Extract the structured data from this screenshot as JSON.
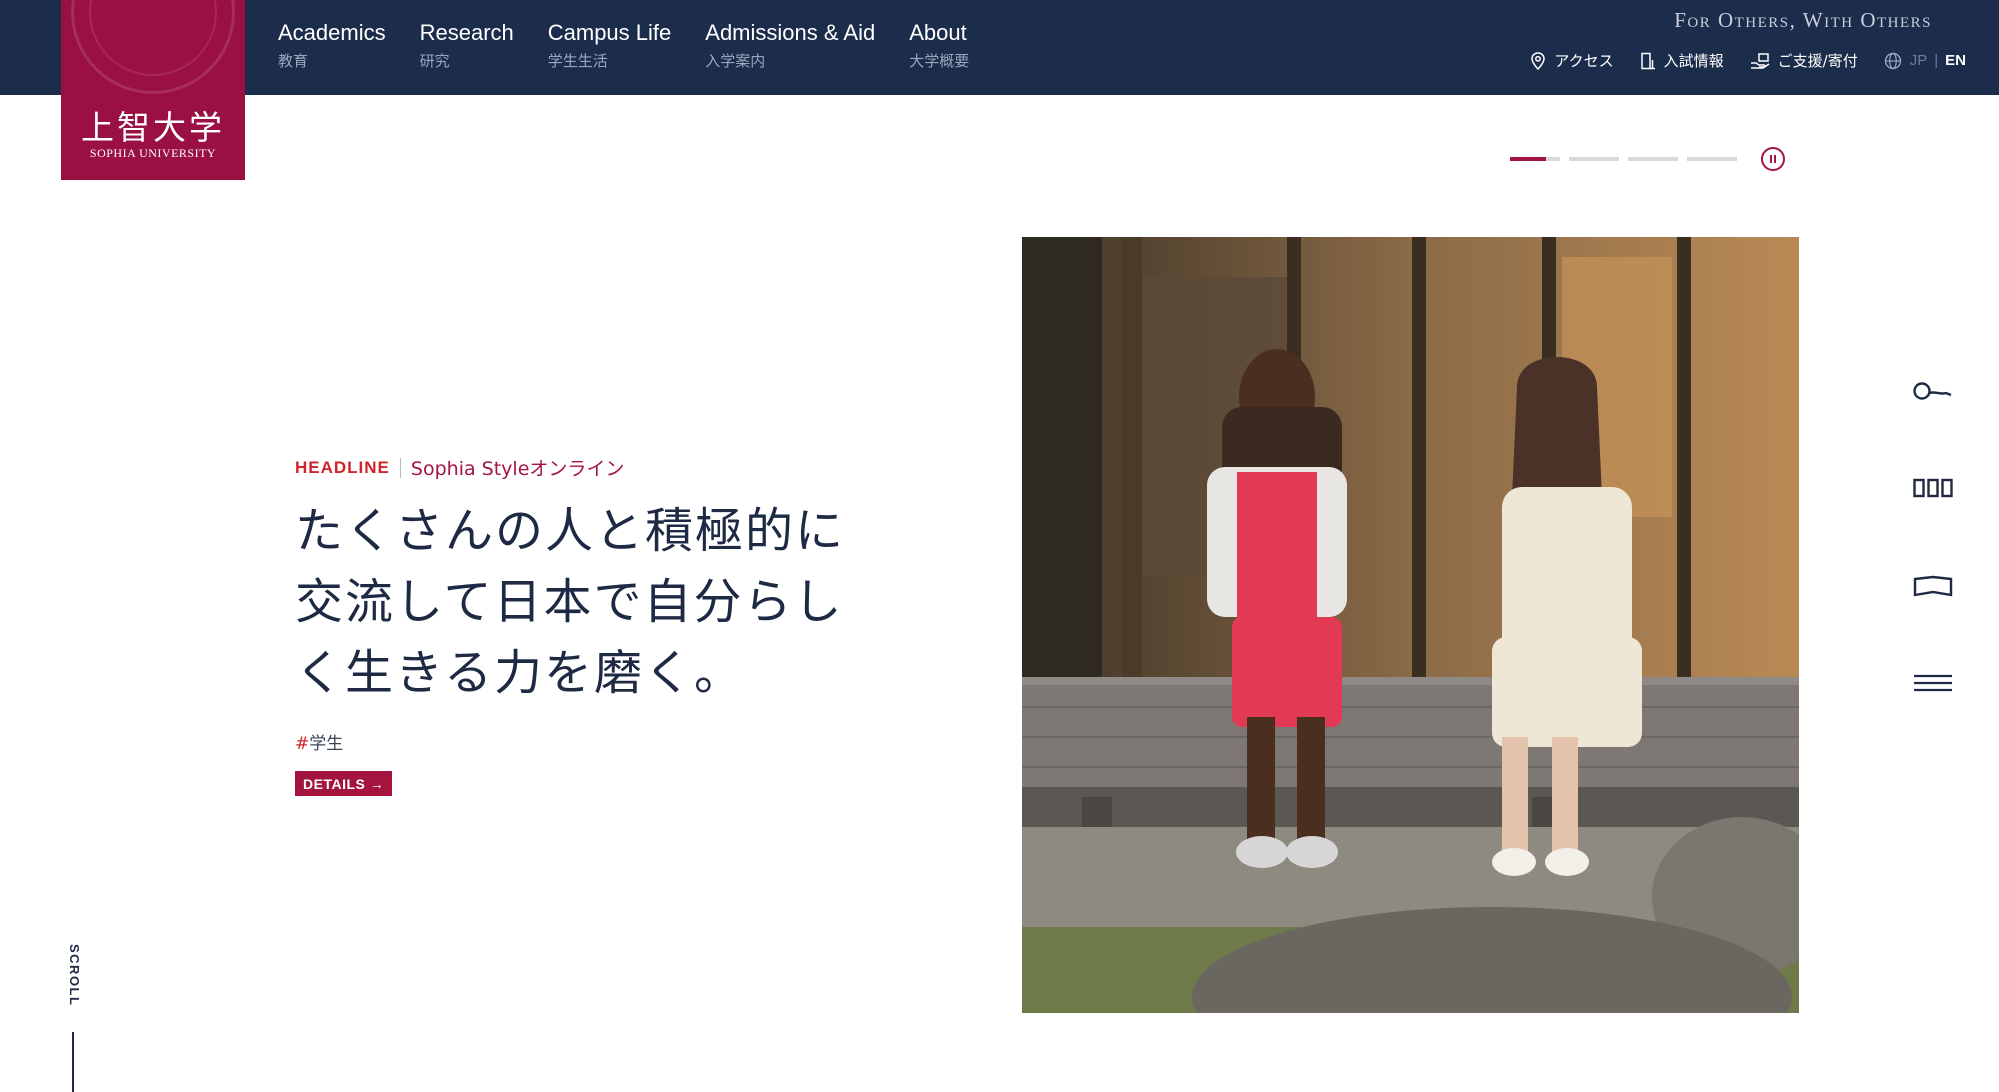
{
  "header": {
    "logo": {
      "kanji": "上智大学",
      "english": "SOPHIA UNIVERSITY"
    },
    "nav": [
      {
        "en": "Academics",
        "jp": "教育"
      },
      {
        "en": "Research",
        "jp": "研究"
      },
      {
        "en": "Campus Life",
        "jp": "学生生活"
      },
      {
        "en": "Admissions & Aid",
        "jp": "入学案内"
      },
      {
        "en": "About",
        "jp": "大学概要"
      }
    ],
    "motto": "For Others, With Others",
    "utility": [
      {
        "label": "アクセス",
        "icon": "map-pin-icon"
      },
      {
        "label": "入試情報",
        "icon": "building-icon"
      },
      {
        "label": "ご支援/寄付",
        "icon": "donation-icon"
      }
    ],
    "lang": {
      "jp": "JP",
      "sep": "|",
      "en": "EN",
      "icon": "globe-icon"
    }
  },
  "slider": {
    "active_index": 0,
    "active_progress": 0.72,
    "count": 4
  },
  "headline": {
    "label": "HEADLINE",
    "source": "Sophia Styleオンライン",
    "title": "たくさんの人と積極的に交流して日本で自分らしく生きる力を磨く。",
    "tag_hash": "#",
    "tag": "学生",
    "details": "DETAILS →"
  },
  "side_menu": [
    {
      "icon": "search-icon"
    },
    {
      "icon": "library-icon"
    },
    {
      "icon": "book-icon"
    },
    {
      "icon": "menu-icon"
    }
  ],
  "scroll": {
    "label": "SCROLL"
  },
  "colors": {
    "navy": "#1c2c4b",
    "crimson": "#9a1042",
    "accent": "#a3153f",
    "headline_red": "#d2232a"
  }
}
